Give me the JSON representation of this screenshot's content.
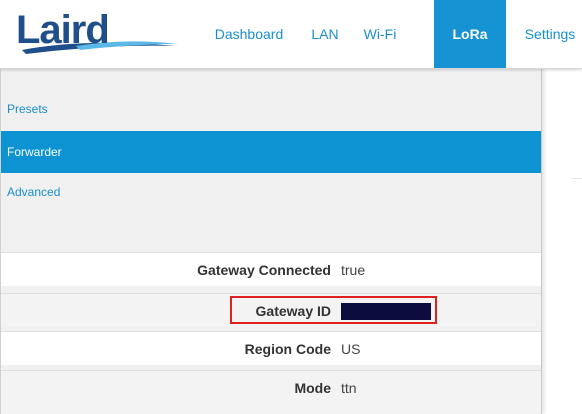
{
  "header": {
    "logo_text": "Laird",
    "nav": [
      {
        "label": "Dashboard"
      },
      {
        "label": "LAN"
      },
      {
        "label": "Wi-Fi"
      },
      {
        "label": "LoRa",
        "active": true
      },
      {
        "label": "Settings"
      }
    ]
  },
  "sidebar": {
    "items": [
      {
        "label": "Presets"
      },
      {
        "label": "Forwarder",
        "active": true
      },
      {
        "label": "Advanced"
      }
    ]
  },
  "details": [
    {
      "label": "Gateway Connected",
      "value": "true"
    },
    {
      "label": "Gateway ID",
      "value": "",
      "redacted": true,
      "highlighted": true
    },
    {
      "label": "Region Code",
      "value": "US"
    },
    {
      "label": "Mode",
      "value": "ttn"
    }
  ],
  "colors": {
    "accent": "#1593d2",
    "logo": "#1e4f8a",
    "highlight": "#e02020",
    "redaction": "#0c0c3e"
  }
}
